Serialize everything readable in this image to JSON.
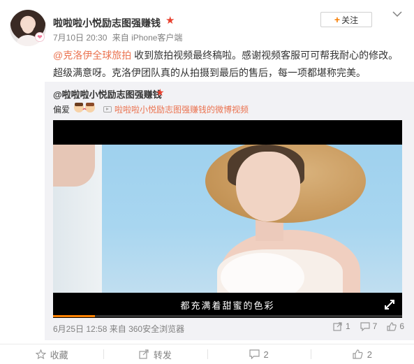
{
  "post": {
    "username": "啦啦啦小悦励志图强赚钱",
    "badge_symbol": "❤",
    "follow_label": "关注",
    "meta": {
      "date": "7月10日 20:30",
      "source": "来自 iPhone客户端"
    },
    "text_mention": "@克洛伊全球旅拍",
    "text_body": " 收到旅拍视频最终稿啦。感谢视频客服可可帮我耐心的修改。超级满意呀。克洛伊团队真的从拍摄到最后的售后，每一项都堪称完美。"
  },
  "repost": {
    "username": "@啦啦啦小悦励志图强赚钱",
    "pianai": "偏爱",
    "video_link": "啦啦啦小悦励志图强赚钱的微博视频",
    "subtitle": "都充满着甜蜜的色彩",
    "progress": 0.12,
    "date": "6月25日 12:58",
    "source": "来自 360安全浏览器",
    "share_count": "1",
    "comment_count": "7",
    "like_count": "6"
  },
  "actions": {
    "favorite": "收藏",
    "forward": "转发",
    "comment": "2",
    "like": "2"
  },
  "colors": {
    "accent": "#eb7350",
    "vip": "#e8402e",
    "follow_plus": "#f77c00",
    "progress": "#ff8200"
  }
}
